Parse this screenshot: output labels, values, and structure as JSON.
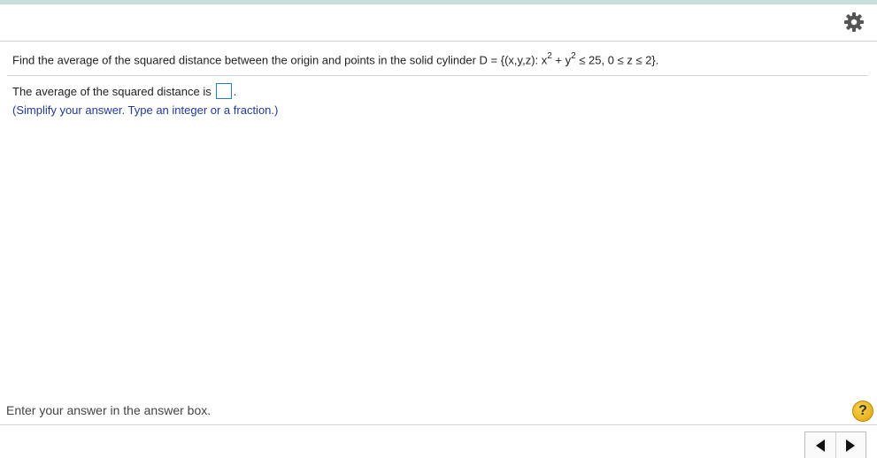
{
  "colors": {
    "top_strip": "#c8dedb",
    "hint_text": "#1f3a93",
    "answer_box_border": "#1e7fc4",
    "help_button": "#f0c020"
  },
  "toolbar": {
    "settings_icon": "gear-icon"
  },
  "question": {
    "text_before": "Find the average of the squared distance between the origin and points in the solid cylinder D = {(x,y,z): x",
    "exp1": "2",
    "text_mid": " + y",
    "exp2": "2",
    "text_after": " ≤ 25, 0 ≤ z ≤ 2}."
  },
  "answer": {
    "prompt": "The average of the squared distance is",
    "value": "",
    "trailing": "."
  },
  "hint": "(Simplify your answer. Type an integer or a fraction.)",
  "footer": {
    "status": "Enter your answer in the answer box.",
    "help_label": "?",
    "prev_icon": "triangle-left-icon",
    "next_icon": "triangle-right-icon"
  }
}
